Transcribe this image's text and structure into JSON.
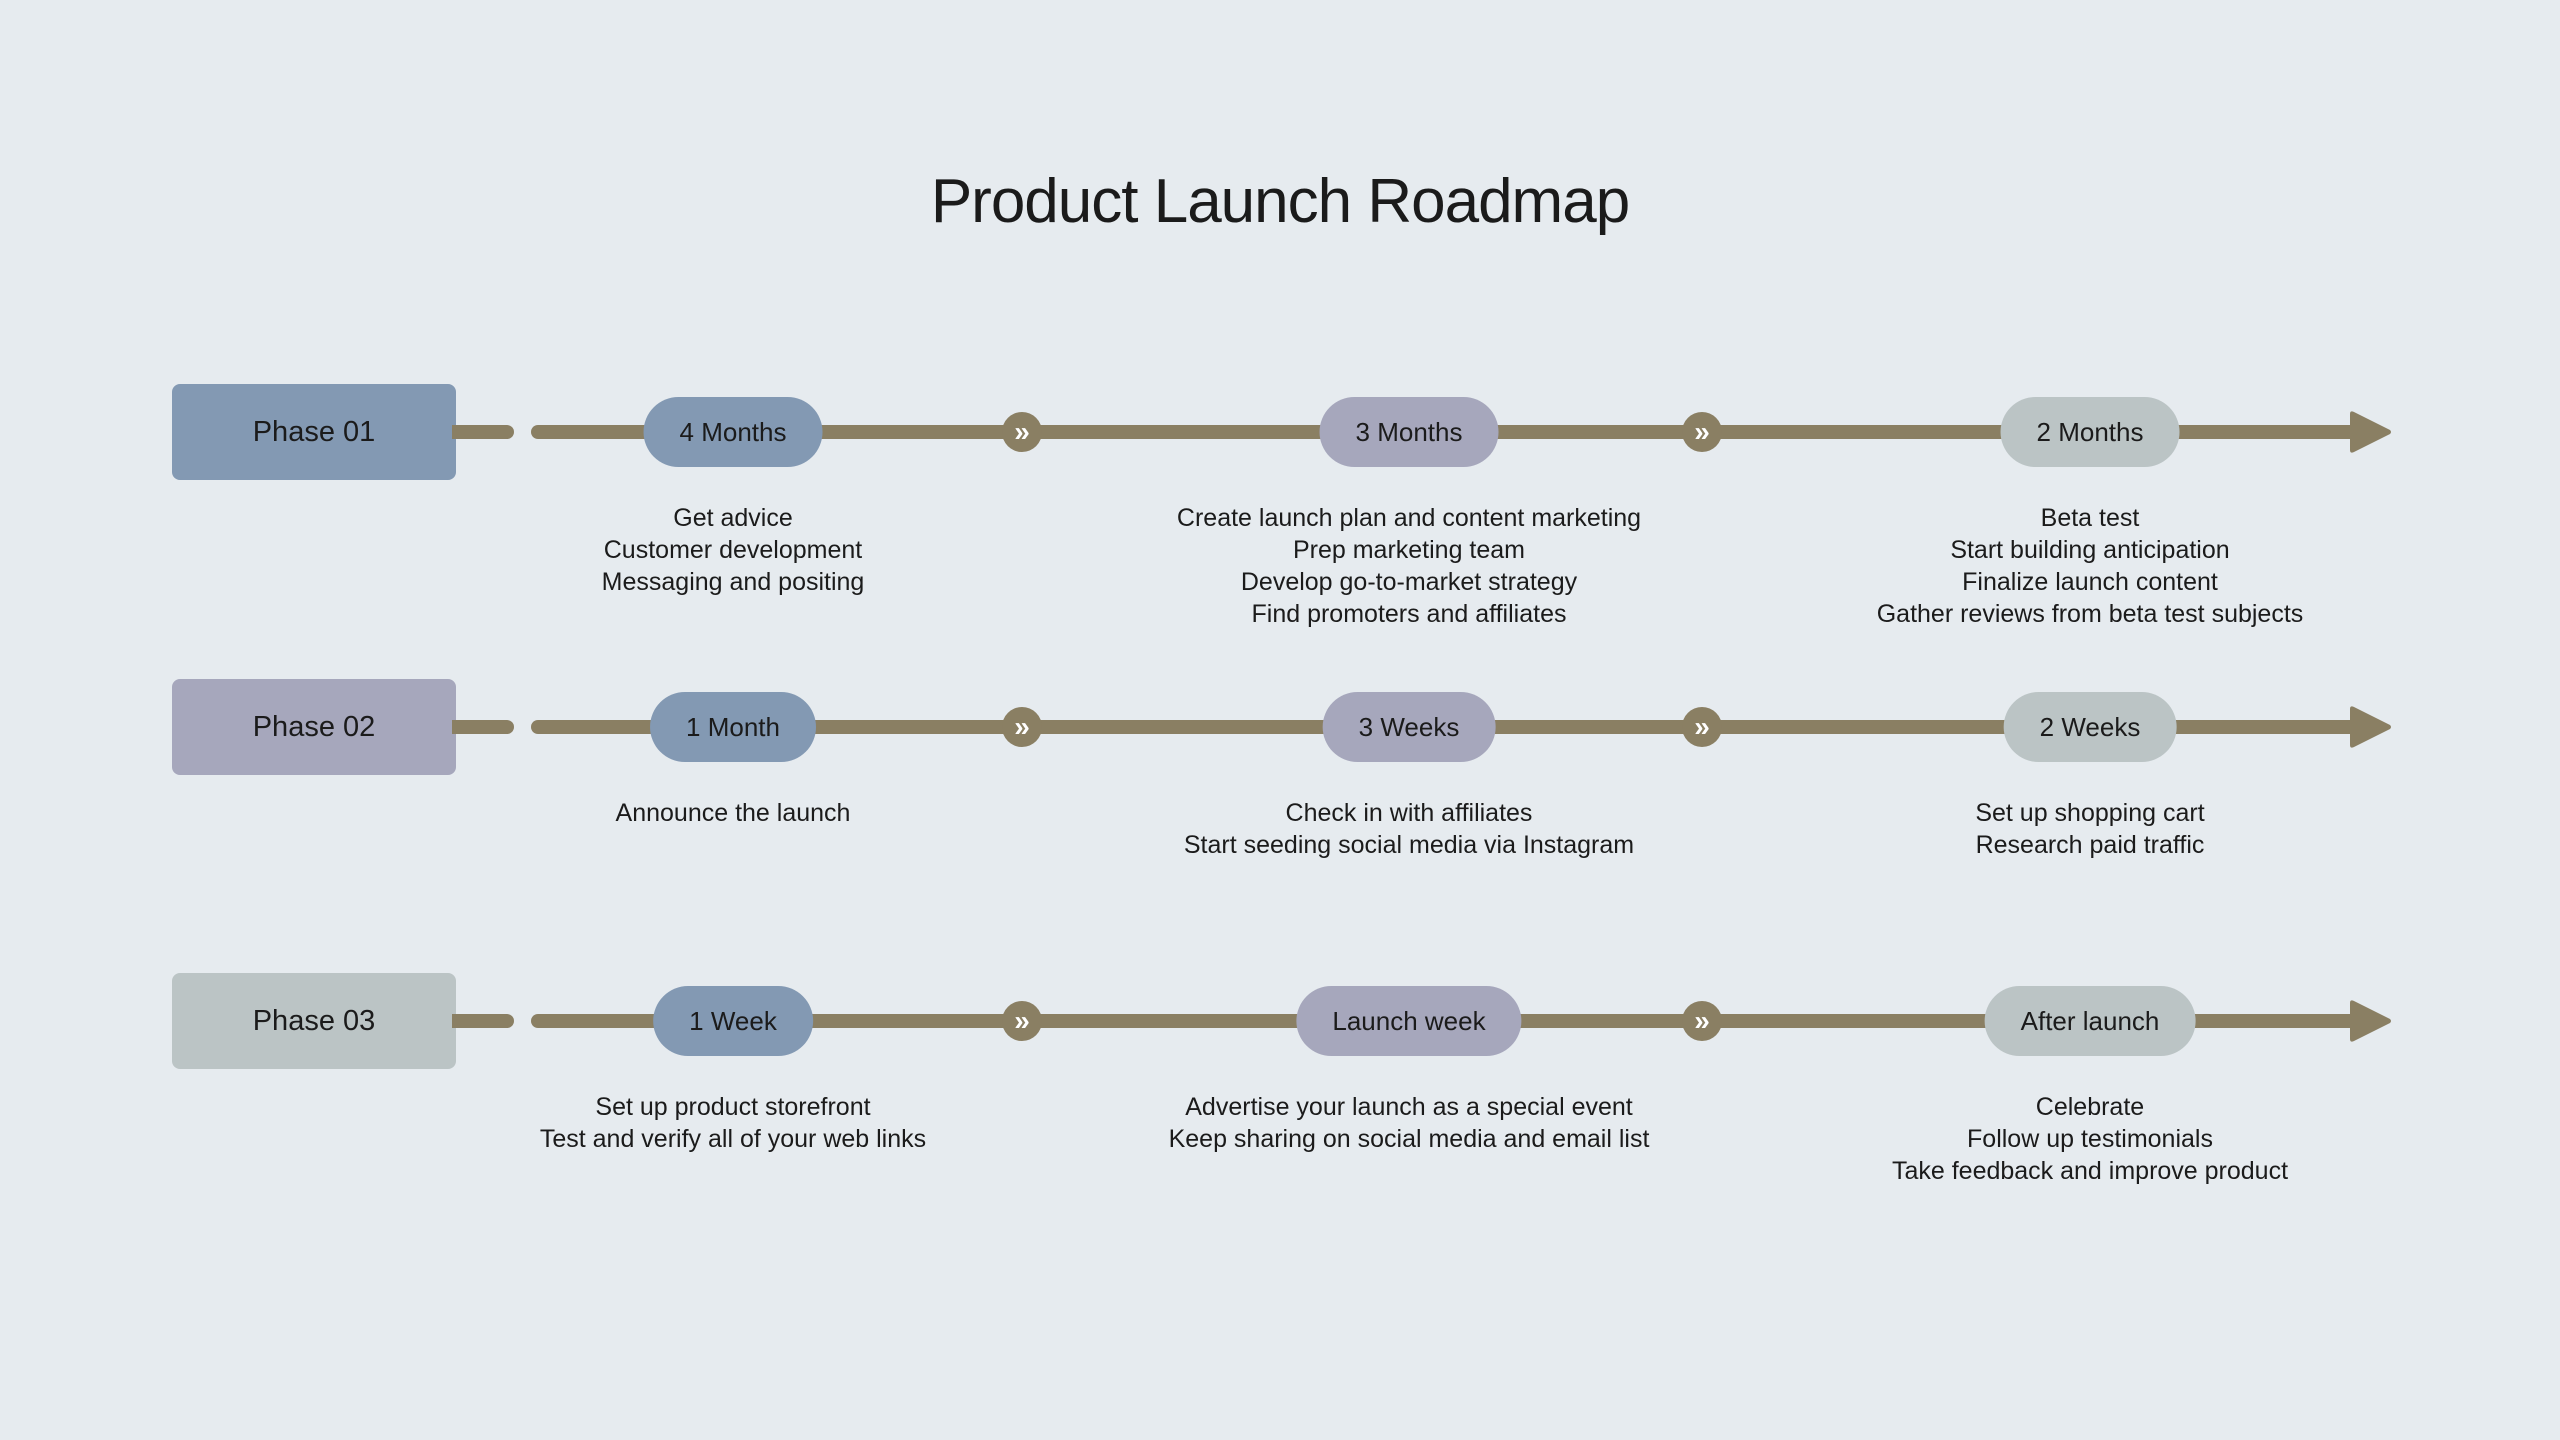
{
  "title": "Product Launch Roadmap",
  "colors": {
    "background": "#e6ebef",
    "connector": "#8a7f63",
    "blue": "#8399b3",
    "lavender": "#a6a7bc",
    "gray": "#bbc4c5",
    "text": "#1b1b1b",
    "chevron_glyph": "#ffffff"
  },
  "chevron_icon": "»",
  "phases": [
    {
      "label": "Phase 01",
      "color": "#8399b3",
      "stages": [
        {
          "duration": "4 Months",
          "color": "#8399b3",
          "tasks": [
            "Get advice",
            "Customer development",
            "Messaging and positing"
          ]
        },
        {
          "duration": "3 Months",
          "color": "#a6a7bc",
          "tasks": [
            "Create launch plan and content marketing",
            "Prep marketing team",
            "Develop go-to-market strategy",
            "Find promoters and affiliates"
          ]
        },
        {
          "duration": "2 Months",
          "color": "#bbc4c5",
          "tasks": [
            "Beta test",
            "Start building anticipation",
            "Finalize launch content",
            "Gather reviews from beta test subjects"
          ]
        }
      ]
    },
    {
      "label": "Phase 02",
      "color": "#a6a7bc",
      "stages": [
        {
          "duration": "1 Month",
          "color": "#8399b3",
          "tasks": [
            "Announce the launch"
          ]
        },
        {
          "duration": "3 Weeks",
          "color": "#a6a7bc",
          "tasks": [
            "Check in with affiliates",
            "Start seeding social media via Instagram"
          ]
        },
        {
          "duration": "2 Weeks",
          "color": "#bbc4c5",
          "tasks": [
            "Set up shopping cart",
            "Research paid traffic"
          ]
        }
      ]
    },
    {
      "label": "Phase 03",
      "color": "#bbc4c5",
      "stages": [
        {
          "duration": "1 Week",
          "color": "#8399b3",
          "tasks": [
            "Set up product storefront",
            "Test and verify all of your web links"
          ]
        },
        {
          "duration": "Launch week",
          "color": "#a6a7bc",
          "tasks": [
            "Advertise your launch as a special event",
            "Keep sharing on social media and email list"
          ]
        },
        {
          "duration": "After launch",
          "color": "#bbc4c5",
          "tasks": [
            "Celebrate",
            "Follow up testimonials",
            "Take feedback and improve product"
          ]
        }
      ]
    }
  ]
}
